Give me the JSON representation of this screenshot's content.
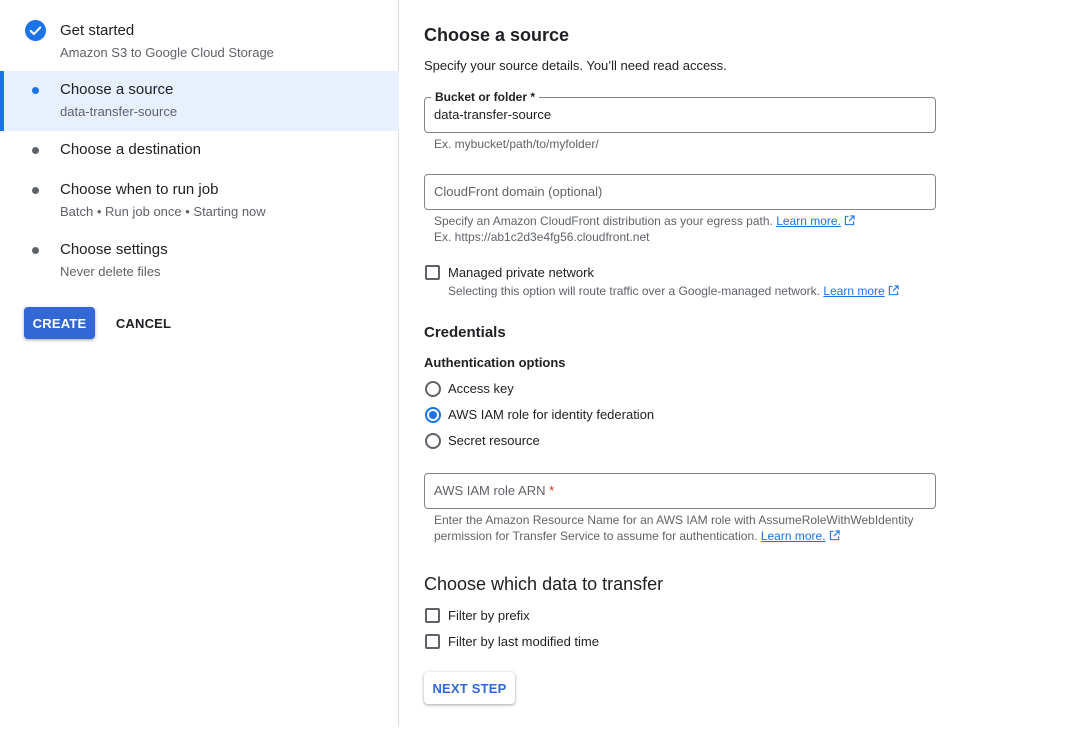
{
  "colors": {
    "accent": "#1a73e8",
    "primary_button": "#3367d6",
    "active_step_bg": "#e8f0fe",
    "required": "#d93025"
  },
  "stepper": {
    "steps": [
      {
        "title": "Get started",
        "subtitle": "Amazon S3 to Google Cloud Storage",
        "status": "completed",
        "icon": "check-circle-icon"
      },
      {
        "title": "Choose a source",
        "subtitle": "data-transfer-source",
        "status": "active",
        "icon": "dot-icon"
      },
      {
        "title": "Choose a destination",
        "subtitle": "",
        "status": "pending",
        "icon": "dot-icon"
      },
      {
        "title": "Choose when to run job",
        "subtitle": "Batch • Run job once • Starting now",
        "status": "pending",
        "icon": "dot-icon"
      },
      {
        "title": "Choose settings",
        "subtitle": "Never delete files",
        "status": "pending",
        "icon": "dot-icon"
      }
    ],
    "create_label": "CREATE",
    "cancel_label": "CANCEL"
  },
  "form": {
    "title": "Choose a source",
    "subtitle": "Specify your source details. You’ll need read access.",
    "bucket": {
      "label": "Bucket or folder *",
      "value": "data-transfer-source",
      "hint": "Ex. mybucket/path/to/myfolder/"
    },
    "cloudfront": {
      "placeholder": "CloudFront domain (optional)",
      "hint": "Specify an Amazon CloudFront distribution as your egress path.",
      "link": "Learn more.",
      "example": "Ex. https://ab1c2d3e4fg56.cloudfront.net"
    },
    "private_network": {
      "label": "Managed private network",
      "checked": false,
      "hint": "Selecting this option will route traffic over a Google-managed network.",
      "link": "Learn more"
    },
    "credentials": {
      "heading": "Credentials",
      "auth_heading": "Authentication options",
      "options": [
        {
          "label": "Access key",
          "selected": false
        },
        {
          "label": "AWS IAM role for identity federation",
          "selected": true
        },
        {
          "label": "Secret resource",
          "selected": false
        }
      ],
      "arn_placeholder": "AWS IAM role ARN",
      "arn_required": "*",
      "arn_hint_line1": "Enter the Amazon Resource Name for an AWS IAM role with AssumeRoleWithWebIdentity",
      "arn_hint_line2": "permission for Transfer Service to assume for authentication.",
      "arn_link": "Learn more."
    },
    "data_filter": {
      "heading": "Choose which data to transfer",
      "options": [
        {
          "label": "Filter by prefix",
          "checked": false
        },
        {
          "label": "Filter by last modified time",
          "checked": false
        }
      ]
    },
    "next_label": "NEXT STEP"
  }
}
